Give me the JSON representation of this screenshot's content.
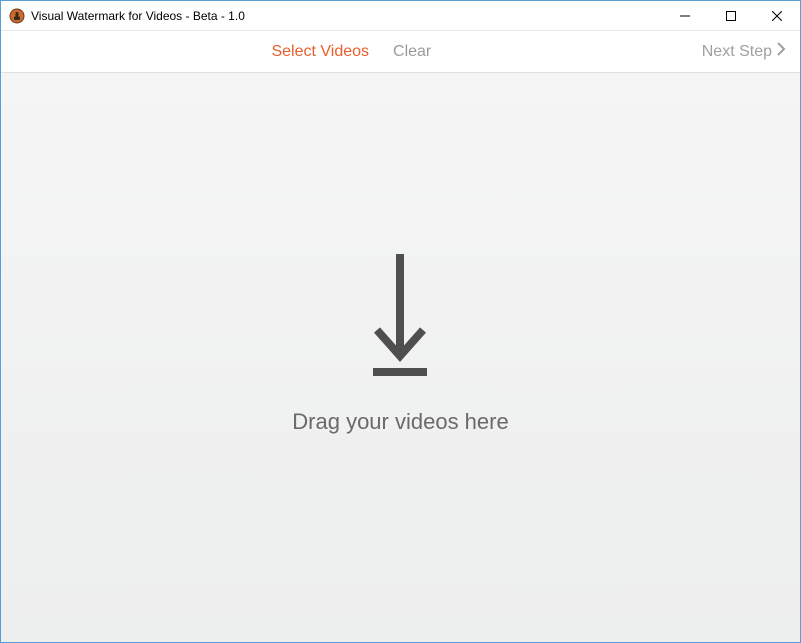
{
  "window": {
    "title": "Visual Watermark for Videos - Beta - 1.0"
  },
  "toolbar": {
    "select_videos": "Select Videos",
    "clear": "Clear",
    "next_step": "Next Step"
  },
  "content": {
    "drop_text": "Drag your videos here"
  },
  "icons": {
    "app": "app-icon",
    "minimize": "minimize",
    "maximize": "maximize",
    "close": "close",
    "chevron_right": "chevron-right",
    "download_arrow": "download-arrow"
  }
}
